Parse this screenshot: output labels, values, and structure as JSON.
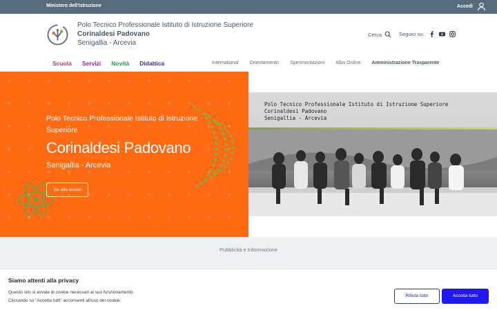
{
  "topbar": {
    "ministry": "Ministero dell'Istruzione",
    "login": "Accedi"
  },
  "header": {
    "school_line1": "Polo Tecnico Professionale Istituto di Istruzione Superiore",
    "school_line2": "Corinaldesi Padovano",
    "school_line3": "Senigallia - Arcevia",
    "search": "Cerca",
    "follow": "Seguici su:",
    "social_icons": [
      "facebook-icon",
      "youtube-icon",
      "instagram-icon"
    ]
  },
  "mainnav": [
    {
      "label": "Scuola",
      "color": "#b23b6b"
    },
    {
      "label": "Servizi",
      "color": "#a21dae"
    },
    {
      "label": "Novità",
      "color": "#2c9a52"
    },
    {
      "label": "Didattica",
      "color": "#3a22b8"
    }
  ],
  "subnav": [
    "International",
    "Orientamento",
    "Sperimentazioni",
    "Albo Online",
    "Amministrazione Trasparente"
  ],
  "hero": {
    "line1": "Polo Tecnico Professionale Istituto di Istruzione Superiore",
    "name": "Corinaldesi Padovano",
    "place": "Senigallia - Arcevia",
    "button": "Vai alla scuola",
    "accent_color": "#ff6a13"
  },
  "photo_caption": {
    "line1": "Polo Tecnico Professionale Istituto di Istruzione Superiore",
    "line2": "Corinaldesi Padovano",
    "line3": "Senigallia - Arcevia"
  },
  "footer": {
    "advertising": "Pubblicità e Informazione"
  },
  "cookie": {
    "title": "Siamo attenti alla privacy",
    "text1": "Questo sito si avvale di cookie necessari al suo funzionamento.",
    "text2": "Cliccando su \"Accetta tutti\" acconsenti all'uso dei cookie.",
    "reject": "Rifiuta tutto",
    "accept": "Accetta tutto"
  }
}
